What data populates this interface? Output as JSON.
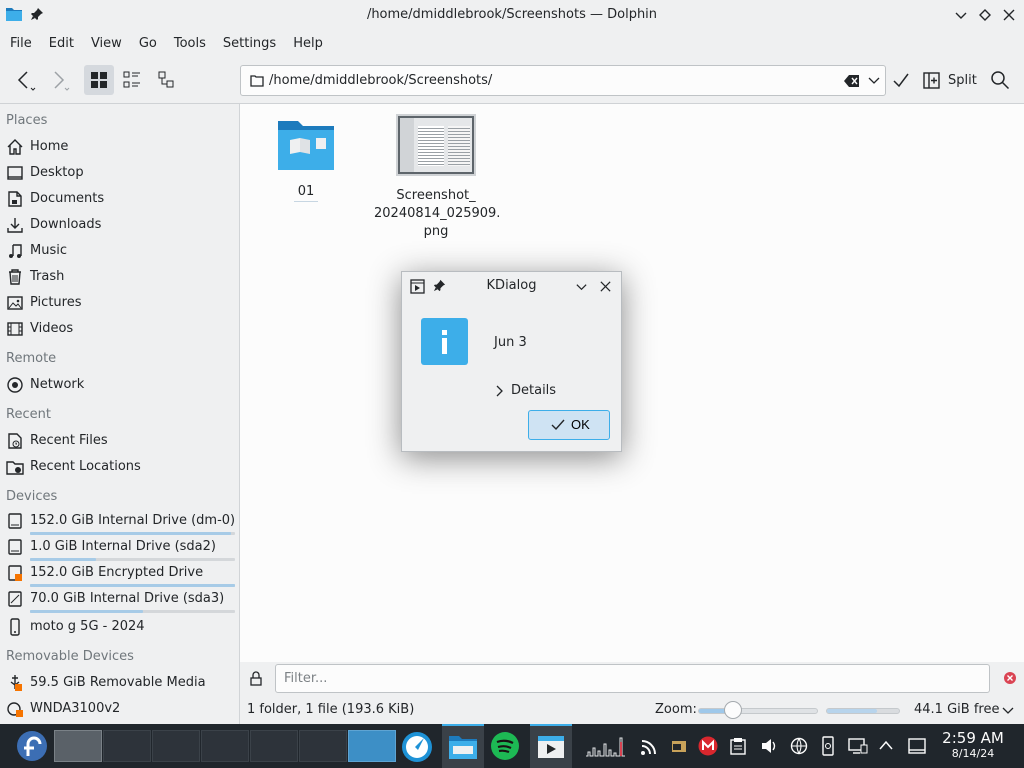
{
  "window": {
    "title": "/home/dmiddlebrook/Screenshots — Dolphin"
  },
  "menu": [
    "File",
    "Edit",
    "View",
    "Go",
    "Tools",
    "Settings",
    "Help"
  ],
  "toolbar": {
    "location": "/home/dmiddlebrook/Screenshots/",
    "split_label": "Split"
  },
  "sidebar": {
    "places_header": "Places",
    "places": [
      {
        "label": "Home",
        "icon": "home-icon"
      },
      {
        "label": "Desktop",
        "icon": "desktop-icon"
      },
      {
        "label": "Documents",
        "icon": "document-icon"
      },
      {
        "label": "Downloads",
        "icon": "download-icon"
      },
      {
        "label": "Music",
        "icon": "music-icon"
      },
      {
        "label": "Trash",
        "icon": "trash-icon"
      },
      {
        "label": "Pictures",
        "icon": "picture-icon"
      },
      {
        "label": "Videos",
        "icon": "video-icon"
      }
    ],
    "remote_header": "Remote",
    "remote": [
      {
        "label": "Network",
        "icon": "network-icon"
      }
    ],
    "recent_header": "Recent",
    "recent": [
      {
        "label": "Recent Files",
        "icon": "recent-files-icon"
      },
      {
        "label": "Recent Locations",
        "icon": "recent-locations-icon"
      }
    ],
    "devices_header": "Devices",
    "devices": [
      {
        "label": "152.0 GiB Internal Drive (dm-0)",
        "icon": "drive-icon",
        "usage": 0.98
      },
      {
        "label": "1.0 GiB Internal Drive (sda2)",
        "icon": "drive-icon",
        "usage": 0.32
      },
      {
        "label": "152.0 GiB Encrypted Drive",
        "icon": "encrypted-drive-icon",
        "usage": 1.0
      },
      {
        "label": "70.0 GiB Internal Drive (sda3)",
        "icon": "drive-icon",
        "usage": 0.55
      },
      {
        "label": "moto g 5G - 2024",
        "icon": "phone-icon"
      }
    ],
    "removable_header": "Removable Devices",
    "removable": [
      {
        "label": "59.5 GiB Removable Media",
        "icon": "usb-icon"
      },
      {
        "label": "WNDA3100v2",
        "icon": "wifi-device-icon"
      }
    ]
  },
  "files": [
    {
      "name": "01",
      "type": "folder"
    },
    {
      "name": "Screenshot_\n20240814_025909.\npng",
      "type": "image"
    }
  ],
  "filter": {
    "placeholder": "Filter..."
  },
  "status": {
    "summary": "1 folder, 1 file (193.6 KiB)",
    "zoom_label": "Zoom:",
    "zoom_level": 0.28,
    "free_space": "44.1 GiB free",
    "used_fraction": 0.7
  },
  "dialog": {
    "title": "KDialog",
    "message": "Jun 3",
    "details_label": "Details",
    "ok_label": "OK"
  },
  "taskbar": {
    "time": "2:59 AM",
    "date": "8/14/24"
  },
  "colors": {
    "accent": "#3daee9",
    "panel": "#20262c",
    "window_bg": "#eff0f1",
    "content_bg": "#fcfcfc",
    "close_red": "#da4453"
  }
}
